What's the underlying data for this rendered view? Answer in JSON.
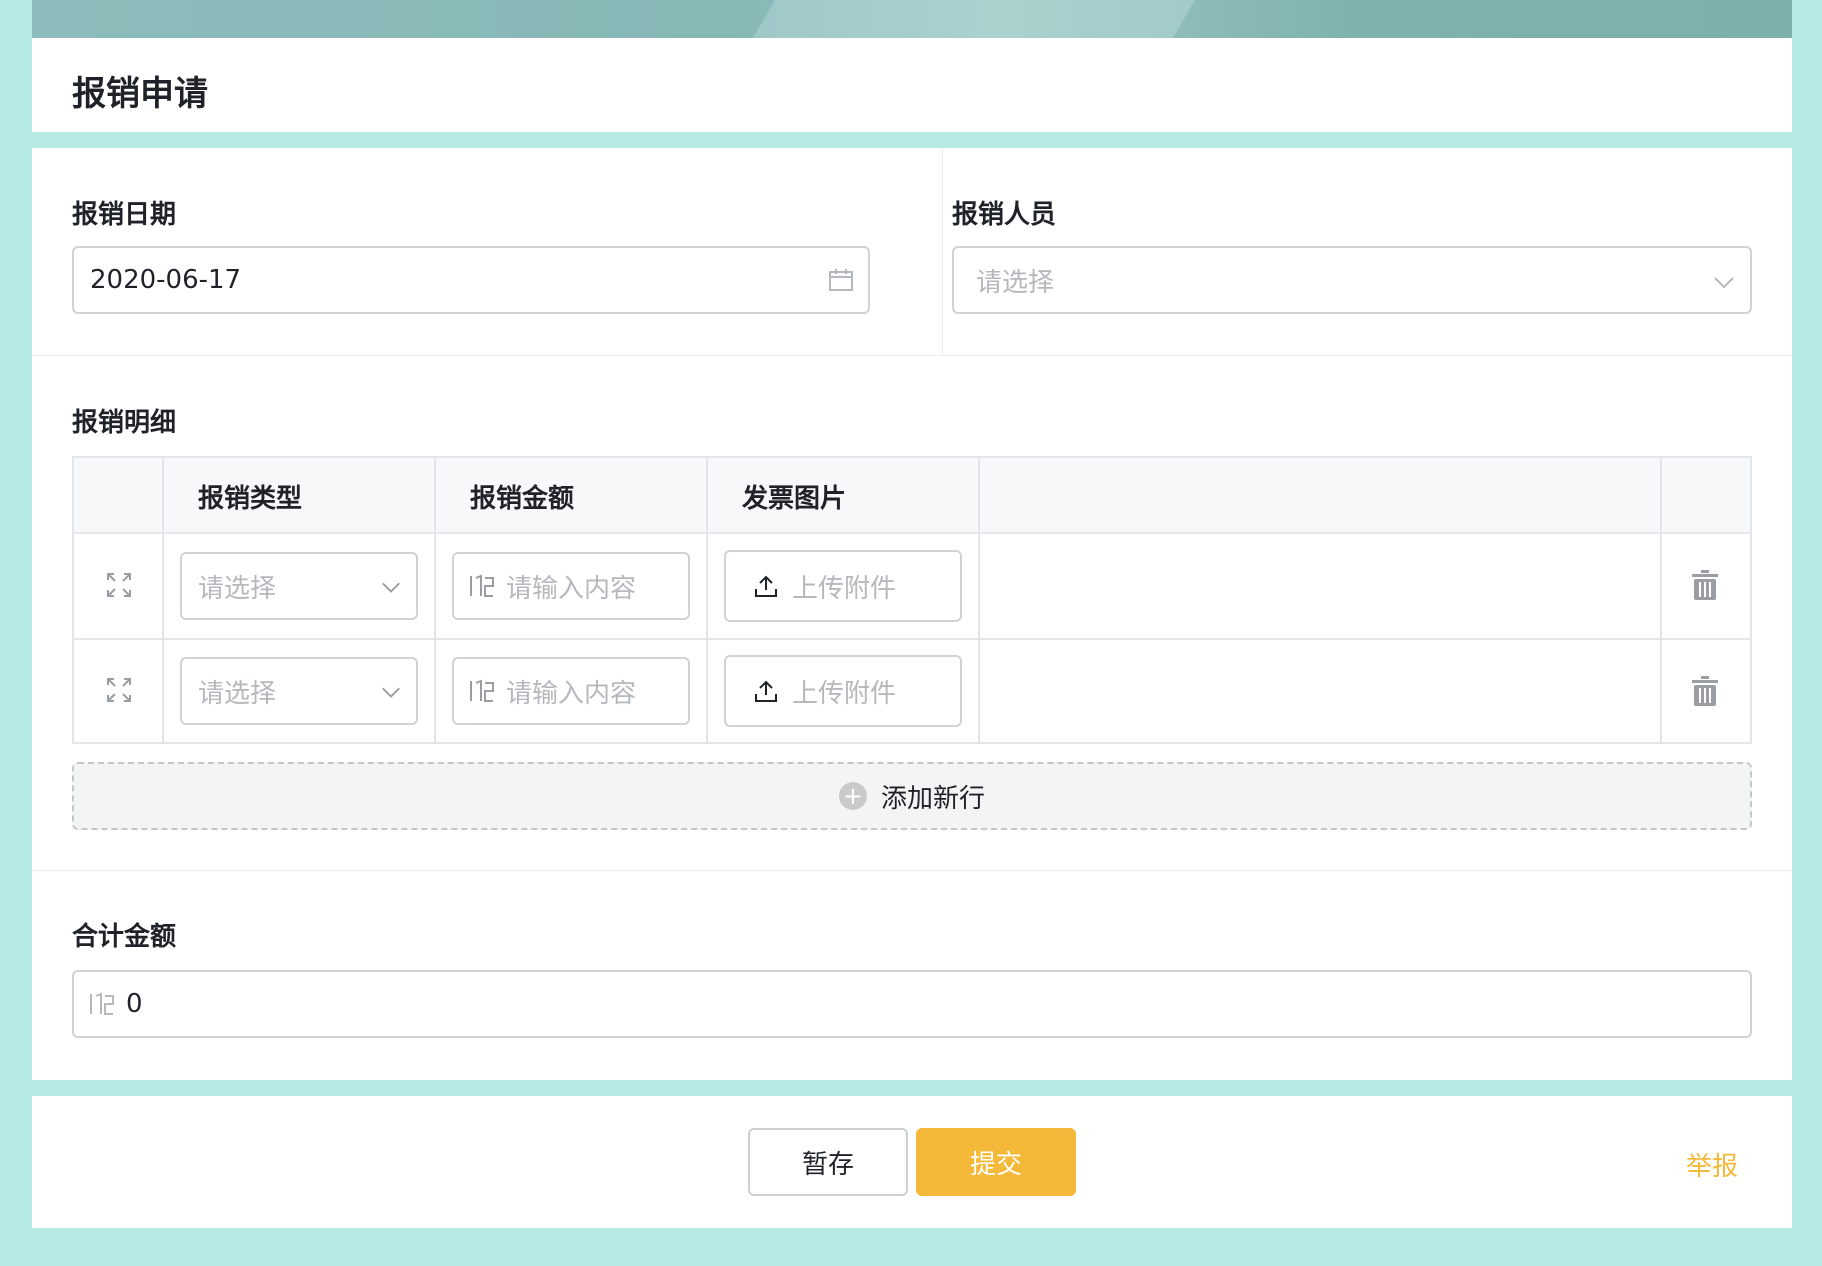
{
  "page": {
    "title": "报销申请"
  },
  "form": {
    "date": {
      "label": "报销日期",
      "value": "2020-06-17",
      "icon": "calendar-icon"
    },
    "person": {
      "label": "报销人员",
      "placeholder": "请选择",
      "icon": "chevron-down-icon"
    }
  },
  "details": {
    "label": "报销明细",
    "columns": [
      "报销类型",
      "报销金额",
      "发票图片"
    ],
    "rows": [
      {
        "type_placeholder": "请选择",
        "amount_placeholder": "请输入内容",
        "upload_label": "上传附件"
      },
      {
        "type_placeholder": "请选择",
        "amount_placeholder": "请输入内容",
        "upload_label": "上传附件"
      }
    ],
    "add_row_label": "添加新行"
  },
  "total": {
    "label": "合计金额",
    "value": "0"
  },
  "footer": {
    "save_label": "暂存",
    "submit_label": "提交",
    "report_label": "举报"
  },
  "colors": {
    "accent": "#f5b93a",
    "background": "#b6ebe5"
  }
}
